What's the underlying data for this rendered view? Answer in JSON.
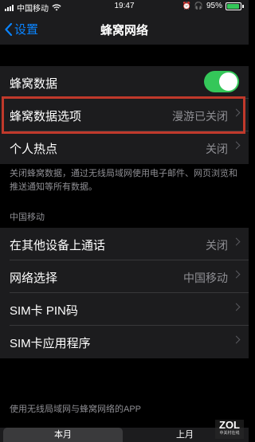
{
  "status": {
    "carrier": "中国移动",
    "time": "19:47",
    "battery": "95%",
    "battery_level": 0.95
  },
  "nav": {
    "back_label": "设置",
    "title": "蜂窝网络"
  },
  "cells": {
    "cellular_data": {
      "label": "蜂窝数据",
      "toggle_on": true
    },
    "cellular_options": {
      "label": "蜂窝数据选项",
      "value": "漫游已关闭"
    },
    "hotspot": {
      "label": "个人热点",
      "value": "关闭"
    }
  },
  "footnote": "关闭蜂窝数据，通过无线局域网使用电子邮件、网页浏览和推送通知等所有数据。",
  "section_header": "中国移动",
  "carrier_cells": {
    "calls_other_devices": {
      "label": "在其他设备上通话",
      "value": "关闭"
    },
    "network_selection": {
      "label": "网络选择",
      "value": "中国移动"
    },
    "sim_pin": {
      "label": "SIM卡 PIN码"
    },
    "sim_apps": {
      "label": "SIM卡应用程序"
    }
  },
  "apps_header": "使用无线局域网与蜂窝网络的APP",
  "segments": {
    "current": "本月",
    "previous": "上月"
  },
  "watermark": {
    "logo": "ZOL",
    "sub": "中关村在线"
  },
  "colors": {
    "accent": "#0a84ff",
    "toggle_on": "#34c759",
    "highlight": "#c0392b"
  }
}
